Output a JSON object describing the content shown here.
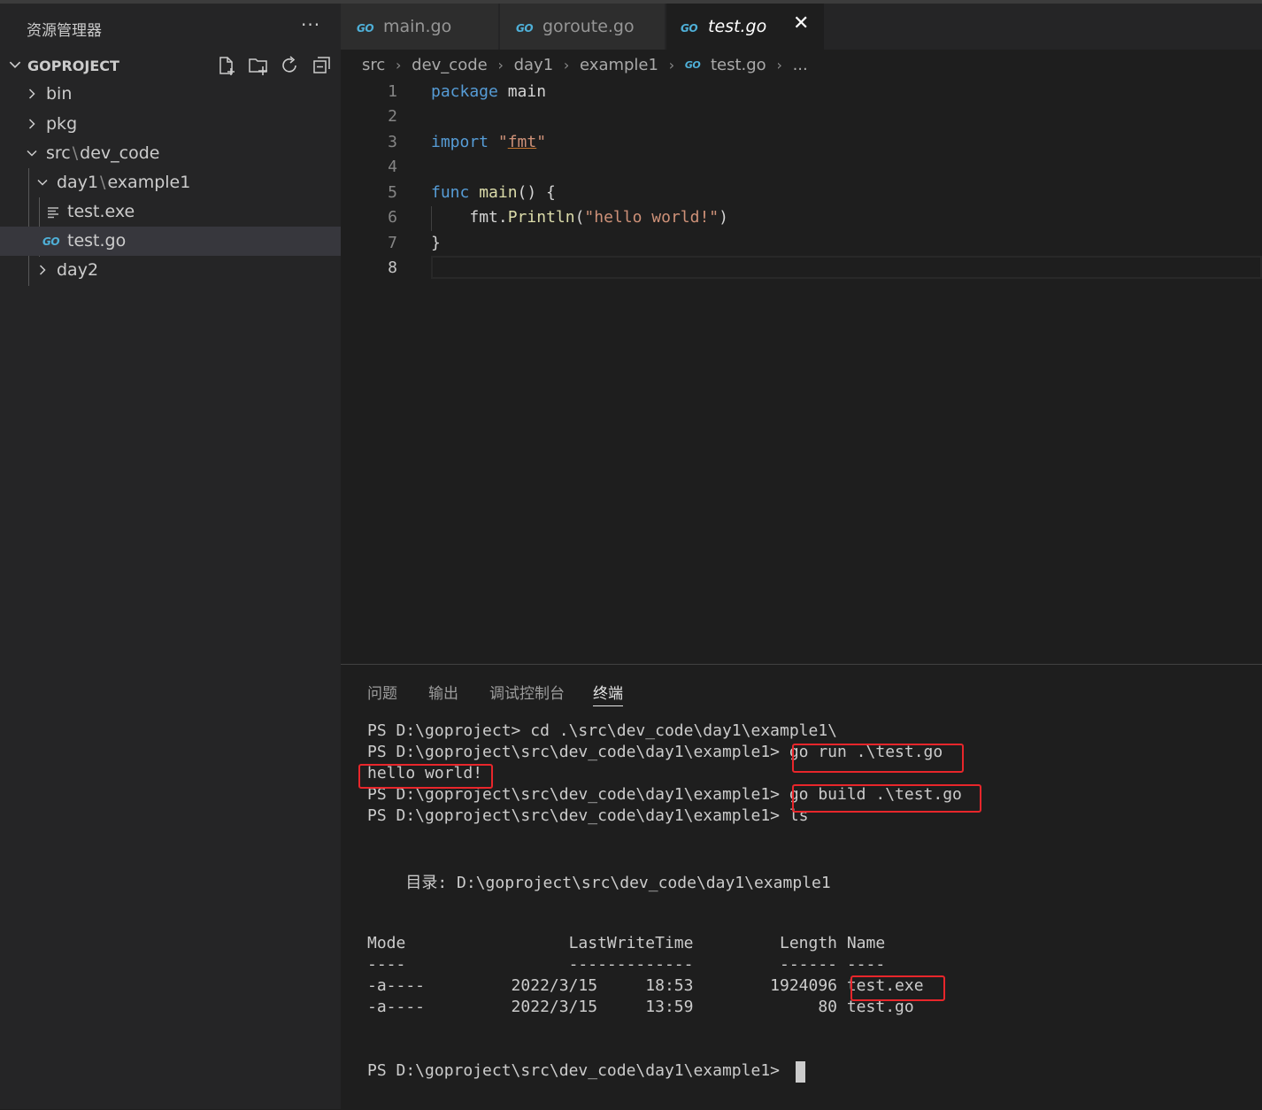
{
  "sidebar": {
    "title": "资源管理器",
    "more": "···",
    "section": "GOPROJECT",
    "actions": [
      "new-file-icon",
      "new-folder-icon",
      "refresh-icon",
      "collapse-all-icon"
    ],
    "tree": {
      "bin": "bin",
      "pkg": "pkg",
      "src_a": "src",
      "src_b": "dev_code",
      "day1_a": "day1",
      "day1_b": "example1",
      "test_exe": "test.exe",
      "test_go": "test.go",
      "day2": "day2"
    }
  },
  "tabs": [
    {
      "label": "main.go",
      "icon": "GO"
    },
    {
      "label": "goroute.go",
      "icon": "GO"
    },
    {
      "label": "test.go",
      "icon": "GO",
      "close": "✕"
    }
  ],
  "breadcrumb": [
    "src",
    "dev_code",
    "day1",
    "example1",
    "test.go",
    "..."
  ],
  "breadcrumb_sep": "›",
  "editor": {
    "line_numbers": [
      "1",
      "2",
      "3",
      "4",
      "5",
      "6",
      "7",
      "8"
    ],
    "l1_kw": "package",
    "l1_name": " main",
    "l3_kw": "import",
    "l3_q1": " \"",
    "l3_pkg": "fmt",
    "l3_q2": "\"",
    "l5_kw": "func",
    "l5_fn": " main",
    "l5_rest": "() {",
    "l6_indent": "    ",
    "l6_obj": "fmt.",
    "l6_fn": "Println",
    "l6_open": "(",
    "l6_str": "\"hello world!\"",
    "l6_close": ")",
    "l7": "}"
  },
  "panel": {
    "tabs": [
      "问题",
      "输出",
      "调试控制台",
      "终端"
    ],
    "terminal": [
      "PS D:\\goproject> cd .\\src\\dev_code\\day1\\example1\\",
      "PS D:\\goproject\\src\\dev_code\\day1\\example1> go run .\\test.go",
      "hello world!",
      "PS D:\\goproject\\src\\dev_code\\day1\\example1> go build .\\test.go",
      "PS D:\\goproject\\src\\dev_code\\day1\\example1> ls",
      "    目录: D:\\goproject\\src\\dev_code\\day1\\example1",
      "Mode                 LastWriteTime         Length Name",
      "----                 -------------         ------ ----",
      "-a----         2022/3/15     18:53        1924096 test.exe",
      "-a----         2022/3/15     13:59             80 test.go",
      "PS D:\\goproject\\src\\dev_code\\day1\\example1> "
    ]
  },
  "colors": {
    "keyword": "#569cd6",
    "function": "#dcdcaa",
    "string": "#ce9178",
    "highlight_box": "#e8262b",
    "go_icon": "#4fb0d8"
  }
}
